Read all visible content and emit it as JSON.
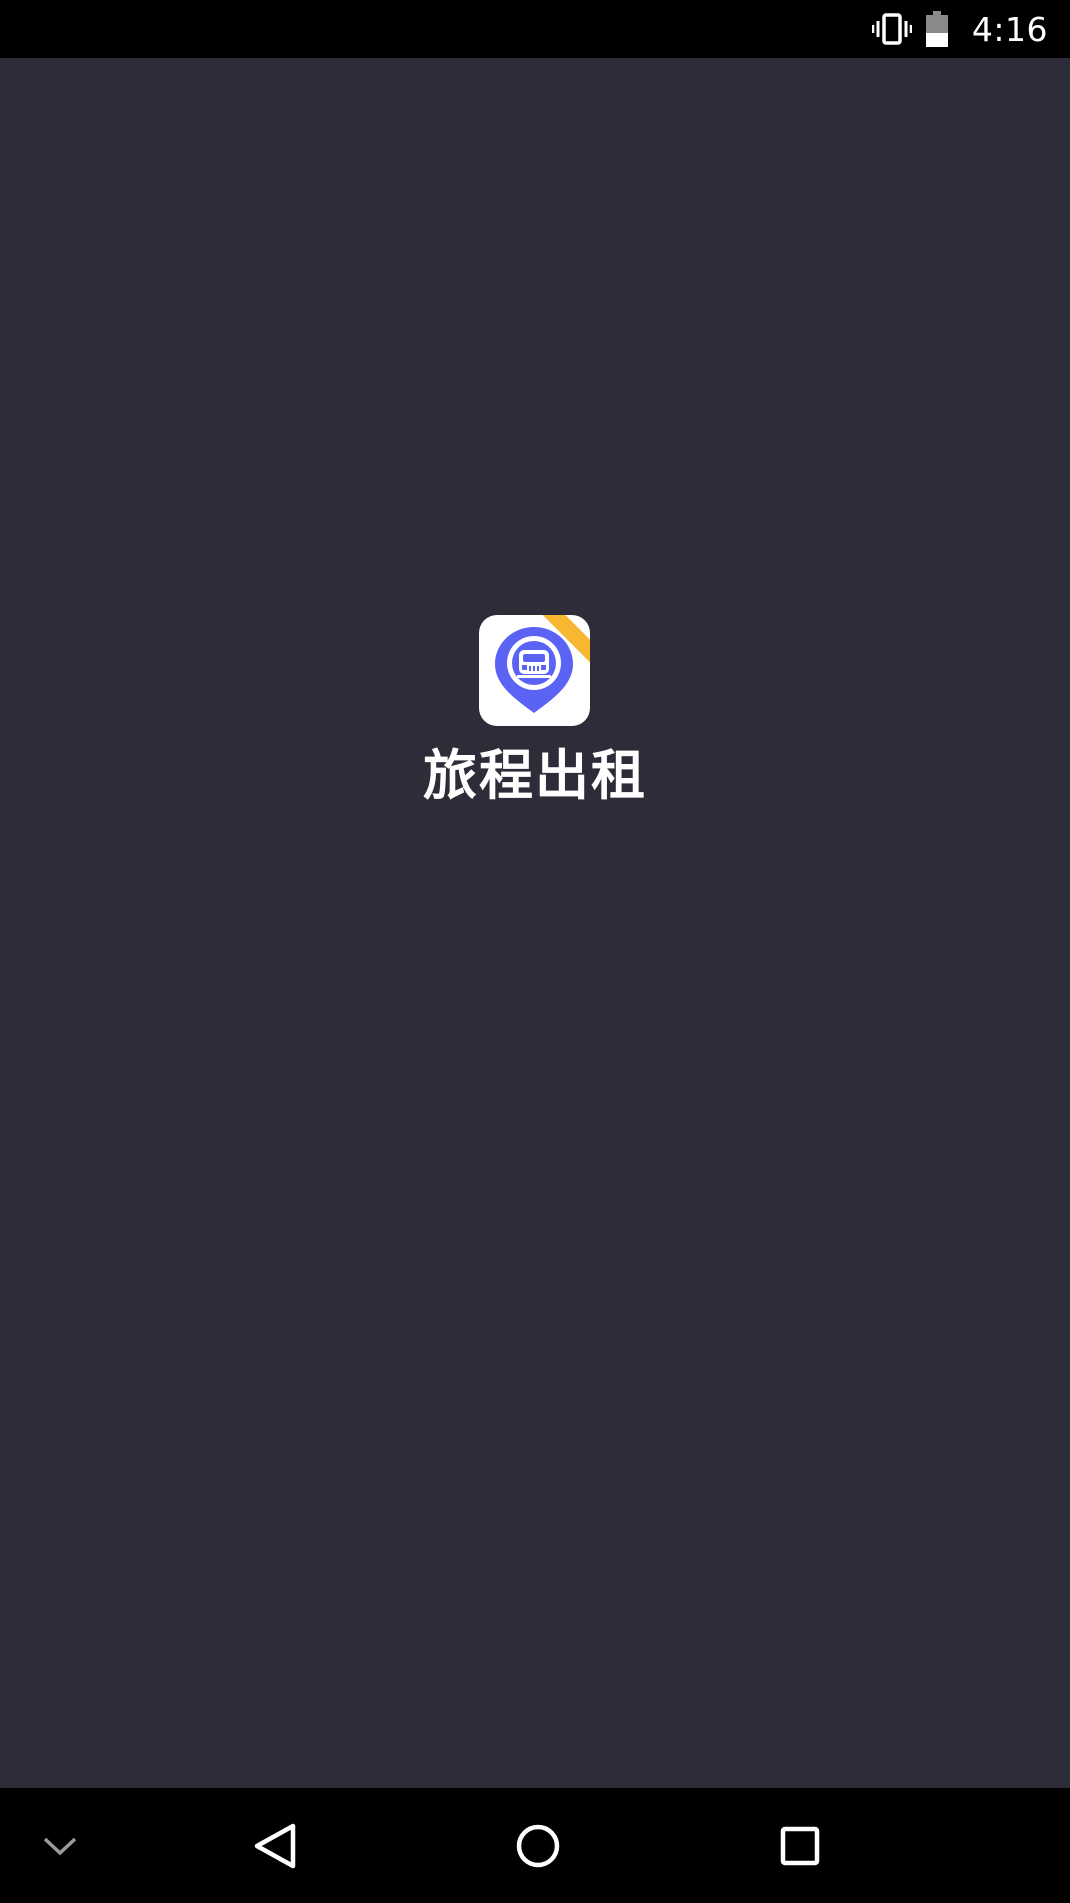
{
  "status_bar": {
    "time": "4:16",
    "icons": [
      "vibrate-icon",
      "battery-icon"
    ]
  },
  "splash": {
    "app_name": "旅程出租",
    "icon": "taxi-location-pin-icon",
    "ribbon_color": "#f7b731",
    "icon_accent": "#5b63f5",
    "background": "#2d2d39"
  },
  "nav_bar": {
    "buttons": [
      "hide-keyboard-icon",
      "back-icon",
      "home-icon",
      "recents-icon"
    ]
  }
}
